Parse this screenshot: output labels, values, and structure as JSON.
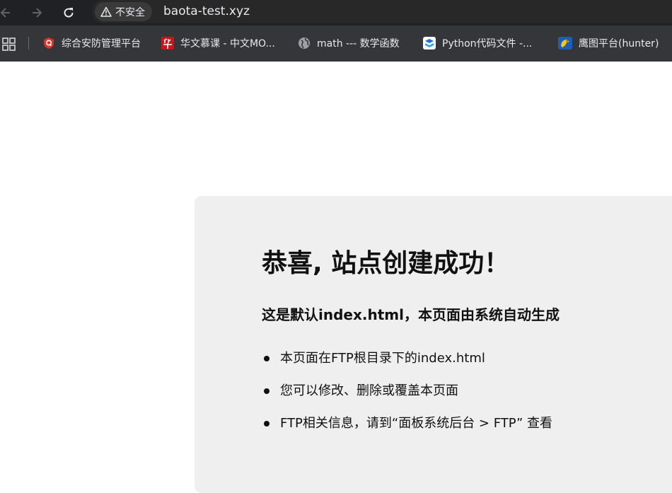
{
  "browser": {
    "security_label": "不安全",
    "url": "baota-test.xyz"
  },
  "bookmarks": [
    {
      "label": "综合安防管理平台",
      "icon": "security-platform-icon"
    },
    {
      "label": "华文慕课 - 中文MO...",
      "icon": "huawen-mooc-icon"
    },
    {
      "label": "math --- 数学函数",
      "icon": "globe-icon"
    },
    {
      "label": "Python代码文件 -...",
      "icon": "python-doc-icon"
    },
    {
      "label": "鹰图平台(hunter)",
      "icon": "hunter-platform-icon"
    }
  ],
  "page": {
    "title": "恭喜, 站点创建成功！",
    "subtitle": "这是默认index.html，本页面由系统自动生成",
    "items": [
      "本页面在FTP根目录下的index.html",
      "您可以修改、删除或覆盖本页面",
      "FTP相关信息，请到“面板系统后台 > FTP” 查看"
    ]
  },
  "colors": {
    "toolbar_bg": "#202124",
    "bookmarks_bg": "#35363a",
    "card_bg": "#efefef"
  }
}
